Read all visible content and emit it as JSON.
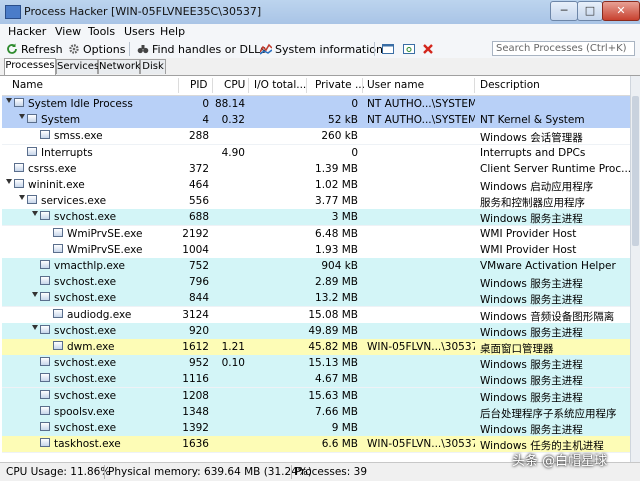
{
  "window": {
    "title": "Process Hacker [WIN-05FLVNEE35C\\30537]",
    "min": "─",
    "max": "□",
    "close": "✕"
  },
  "menu": [
    "Hacker",
    "View",
    "Tools",
    "Users",
    "Help"
  ],
  "toolbar": {
    "refresh": "Refresh",
    "options": "Options",
    "find": "Find handles or DLLs",
    "sysinfo": "System information"
  },
  "search": {
    "placeholder": "Search Processes (Ctrl+K)"
  },
  "tabs": [
    "Processes",
    "Services",
    "Network",
    "Disk"
  ],
  "columns": {
    "name": "Name",
    "pid": "PID",
    "cpu": "CPU",
    "io": "I/O total...",
    "priv": "Private ...",
    "user": "User name",
    "desc": "Description"
  },
  "processes": [
    {
      "name": "System Idle Process",
      "pid": "0",
      "cpu": "88.14",
      "io": "",
      "priv": "0",
      "user": "NT AUTHO...\\SYSTEM",
      "desc": "",
      "level": 1,
      "expand": true,
      "color": "#b8d0f7"
    },
    {
      "name": "System",
      "pid": "4",
      "cpu": "0.32",
      "io": "",
      "priv": "52 kB",
      "user": "NT AUTHO...\\SYSTEM",
      "desc": "NT Kernel & System",
      "level": 2,
      "expand": true,
      "color": "#b8d0f7"
    },
    {
      "name": "smss.exe",
      "pid": "288",
      "cpu": "",
      "io": "",
      "priv": "260 kB",
      "user": "",
      "desc": "Windows 会话管理器",
      "level": 3,
      "expand": false,
      "color": "#ffffff"
    },
    {
      "name": "Interrupts",
      "pid": "",
      "cpu": "4.90",
      "io": "",
      "priv": "0",
      "user": "",
      "desc": "Interrupts and DPCs",
      "level": 2,
      "expand": false,
      "color": "#ffffff"
    },
    {
      "name": "csrss.exe",
      "pid": "372",
      "cpu": "",
      "io": "",
      "priv": "1.39 MB",
      "user": "",
      "desc": "Client Server Runtime Proc...",
      "level": 1,
      "expand": false,
      "color": "#ffffff"
    },
    {
      "name": "wininit.exe",
      "pid": "464",
      "cpu": "",
      "io": "",
      "priv": "1.02 MB",
      "user": "",
      "desc": "Windows 启动应用程序",
      "level": 1,
      "expand": true,
      "color": "#ffffff"
    },
    {
      "name": "services.exe",
      "pid": "556",
      "cpu": "",
      "io": "",
      "priv": "3.77 MB",
      "user": "",
      "desc": "服务和控制器应用程序",
      "level": 2,
      "expand": true,
      "color": "#ffffff"
    },
    {
      "name": "svchost.exe",
      "pid": "688",
      "cpu": "",
      "io": "",
      "priv": "3 MB",
      "user": "",
      "desc": "Windows 服务主进程",
      "level": 3,
      "expand": true,
      "color": "#d3f5f7"
    },
    {
      "name": "WmiPrvSE.exe",
      "pid": "2192",
      "cpu": "",
      "io": "",
      "priv": "6.48 MB",
      "user": "",
      "desc": "WMI Provider Host",
      "level": 4,
      "expand": false,
      "color": "#ffffff"
    },
    {
      "name": "WmiPrvSE.exe",
      "pid": "1004",
      "cpu": "",
      "io": "",
      "priv": "1.93 MB",
      "user": "",
      "desc": "WMI Provider Host",
      "level": 4,
      "expand": false,
      "color": "#ffffff"
    },
    {
      "name": "vmacthlp.exe",
      "pid": "752",
      "cpu": "",
      "io": "",
      "priv": "904 kB",
      "user": "",
      "desc": "VMware Activation Helper",
      "level": 3,
      "expand": false,
      "color": "#d3f5f7"
    },
    {
      "name": "svchost.exe",
      "pid": "796",
      "cpu": "",
      "io": "",
      "priv": "2.89 MB",
      "user": "",
      "desc": "Windows 服务主进程",
      "level": 3,
      "expand": false,
      "color": "#d3f5f7"
    },
    {
      "name": "svchost.exe",
      "pid": "844",
      "cpu": "",
      "io": "",
      "priv": "13.2 MB",
      "user": "",
      "desc": "Windows 服务主进程",
      "level": 3,
      "expand": true,
      "color": "#d3f5f7"
    },
    {
      "name": "audiodg.exe",
      "pid": "3124",
      "cpu": "",
      "io": "",
      "priv": "15.08 MB",
      "user": "",
      "desc": "Windows 音频设备图形隔离",
      "level": 4,
      "expand": false,
      "color": "#ffffff"
    },
    {
      "name": "svchost.exe",
      "pid": "920",
      "cpu": "",
      "io": "",
      "priv": "49.89 MB",
      "user": "",
      "desc": "Windows 服务主进程",
      "level": 3,
      "expand": true,
      "color": "#d3f5f7"
    },
    {
      "name": "dwm.exe",
      "pid": "1612",
      "cpu": "1.21",
      "io": "",
      "priv": "45.82 MB",
      "user": "WIN-05FLVN...\\30537",
      "desc": "桌面窗口管理器",
      "level": 4,
      "expand": false,
      "color": "#fdfcb6"
    },
    {
      "name": "svchost.exe",
      "pid": "952",
      "cpu": "0.10",
      "io": "",
      "priv": "15.13 MB",
      "user": "",
      "desc": "Windows 服务主进程",
      "level": 3,
      "expand": false,
      "color": "#d3f5f7"
    },
    {
      "name": "svchost.exe",
      "pid": "1116",
      "cpu": "",
      "io": "",
      "priv": "4.67 MB",
      "user": "",
      "desc": "Windows 服务主进程",
      "level": 3,
      "expand": false,
      "color": "#d3f5f7"
    },
    {
      "name": "svchost.exe",
      "pid": "1208",
      "cpu": "",
      "io": "",
      "priv": "15.63 MB",
      "user": "",
      "desc": "Windows 服务主进程",
      "level": 3,
      "expand": false,
      "color": "#d3f5f7"
    },
    {
      "name": "spoolsv.exe",
      "pid": "1348",
      "cpu": "",
      "io": "",
      "priv": "7.66 MB",
      "user": "",
      "desc": "后台处理程序子系统应用程序",
      "level": 3,
      "expand": false,
      "color": "#d3f5f7"
    },
    {
      "name": "svchost.exe",
      "pid": "1392",
      "cpu": "",
      "io": "",
      "priv": "9 MB",
      "user": "",
      "desc": "Windows 服务主进程",
      "level": 3,
      "expand": false,
      "color": "#d3f5f7"
    },
    {
      "name": "taskhost.exe",
      "pid": "1636",
      "cpu": "",
      "io": "",
      "priv": "6.6 MB",
      "user": "WIN-05FLVN...\\30537",
      "desc": "Windows 任务的主机进程",
      "level": 3,
      "expand": false,
      "color": "#fdfcb6"
    }
  ],
  "status": {
    "cpu": "CPU Usage: 11.86%",
    "mem": "Physical memory: 639.64 MB (31.24%)",
    "procs": "Processes: 39"
  },
  "watermark": "头条 @白帽星球"
}
